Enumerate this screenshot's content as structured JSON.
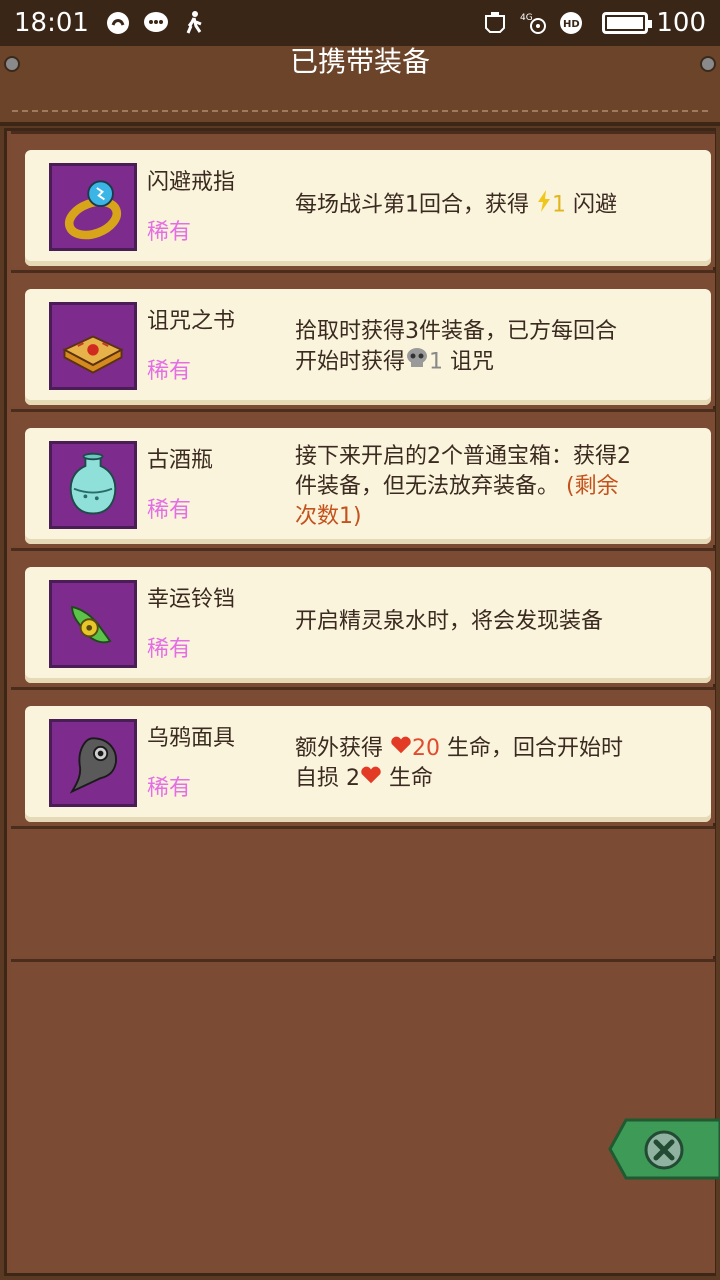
{
  "status_bar": {
    "time": "18:01",
    "battery": "100",
    "network": "4G"
  },
  "header": {
    "title": "已携带装备"
  },
  "items": [
    {
      "name": "闪避戒指",
      "rarity": "稀有",
      "icon": "ring-icon",
      "desc": {
        "before": "每场战斗第1回合，获得 ",
        "num": "1",
        "after": " 闪避"
      }
    },
    {
      "name": "诅咒之书",
      "rarity": "稀有",
      "icon": "book-icon",
      "desc": {
        "line1": "拾取时获得3件装备，已方每回合",
        "line2_before": "开始时获得",
        "num": "1",
        "line2_after": " 诅咒"
      }
    },
    {
      "name": "古酒瓶",
      "rarity": "稀有",
      "icon": "vase-icon",
      "desc": {
        "line1": "接下来开启的2个普通宝箱：获得2",
        "line2": "件装备，但无法放弃装备。",
        "extra": " (剩余",
        "line3": "次数1)"
      }
    },
    {
      "name": "幸运铃铛",
      "rarity": "稀有",
      "icon": "bell-icon",
      "desc": {
        "text": "开启精灵泉水时，将会发现装备"
      }
    },
    {
      "name": "乌鸦面具",
      "rarity": "稀有",
      "icon": "crow-mask-icon",
      "desc": {
        "line1_before": "额外获得 ",
        "num": "20",
        "line1_after": " 生命，回合开始时",
        "line2_before": "自损 2",
        "line2_after": " 生命"
      }
    }
  ],
  "colors": {
    "card": "#fbf4dd",
    "rarity": "#e46fe4",
    "thumb": "#7d2b8c",
    "close_tab": "#3e9b57"
  }
}
